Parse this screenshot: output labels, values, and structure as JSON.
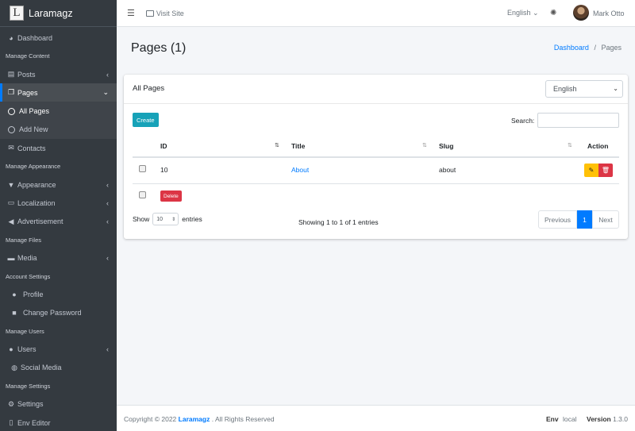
{
  "brand": {
    "logo_letter": "L",
    "name": "Laramagz"
  },
  "sidebar": {
    "dashboard": "Dashboard",
    "h_content": "Manage Content",
    "posts": "Posts",
    "pages": "Pages",
    "all_pages": "All Pages",
    "add_new": "Add New",
    "contacts": "Contacts",
    "h_appearance": "Manage Appearance",
    "appearance": "Appearance",
    "localization": "Localization",
    "advertisement": "Advertisement",
    "h_files": "Manage Files",
    "media": "Media",
    "h_account": "Account Settings",
    "profile": "Profile",
    "change_password": "Change Password",
    "h_users": "Manage Users",
    "users": "Users",
    "social_media": "Social Media",
    "h_settings": "Manage Settings",
    "settings": "Settings",
    "env_editor": "Env Editor"
  },
  "topbar": {
    "visit_site": "Visit Site",
    "language": "English",
    "user": "Mark Otto"
  },
  "page": {
    "title": "Pages (1)",
    "crumb_home": "Dashboard",
    "crumb_sep": "/",
    "crumb_current": "Pages"
  },
  "card": {
    "title": "All Pages",
    "lang_select": "English",
    "create": "Create",
    "search_label": "Search:",
    "columns": {
      "id": "ID",
      "title": "Title",
      "slug": "Slug",
      "action": "Action"
    },
    "rows": [
      {
        "id": "10",
        "title": "About",
        "slug": "about"
      }
    ],
    "delete": "Delete",
    "show": "Show",
    "show_value": "10",
    "entries": "entries",
    "info": "Showing 1 to 1 of 1 entries",
    "prev": "Previous",
    "page": "1",
    "next": "Next"
  },
  "footer": {
    "copy_prefix": "Copyright © 2022",
    "copy_brand": "Laramagz",
    "copy_suffix": ". All Rights Reserved",
    "env_label": "Env",
    "env_value": "local",
    "version_label": "Version",
    "version_value": "1.3.0"
  },
  "colors": {
    "accent": "#007bff",
    "sidebar": "#343a40",
    "create": "#17a2b8",
    "danger": "#dc3545",
    "warning": "#ffc107"
  }
}
